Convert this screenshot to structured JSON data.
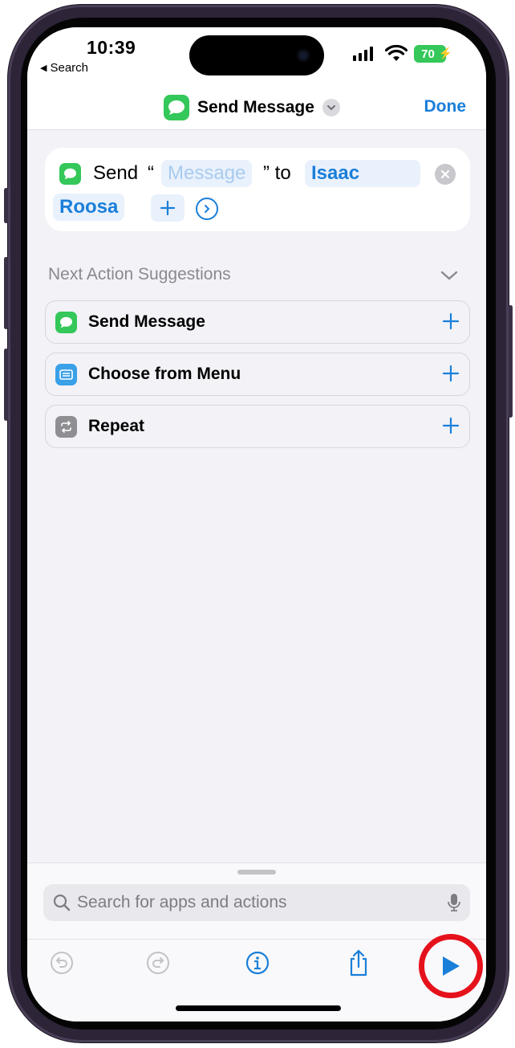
{
  "status_bar": {
    "time": "10:39",
    "back_label": "Search",
    "battery": "70"
  },
  "nav": {
    "title": "Send Message",
    "done_label": "Done"
  },
  "action": {
    "verb": "Send",
    "open_quote": "“",
    "message_placeholder": "Message",
    "close_quote_to": "” to",
    "recipient_first": "Isaac",
    "recipient_last": "Roosa"
  },
  "suggestions": {
    "header": "Next Action Suggestions",
    "items": [
      {
        "label": "Send Message",
        "icon": "messages-icon",
        "color": "#34c759"
      },
      {
        "label": "Choose from Menu",
        "icon": "menu-icon",
        "color": "#3aa0e8"
      },
      {
        "label": "Repeat",
        "icon": "repeat-icon",
        "color": "#8e8e93"
      }
    ]
  },
  "search": {
    "placeholder": "Search for apps and actions"
  },
  "colors": {
    "accent": "#1a7fd9",
    "messages_green": "#34c759",
    "highlight_ring": "#e5121b"
  }
}
